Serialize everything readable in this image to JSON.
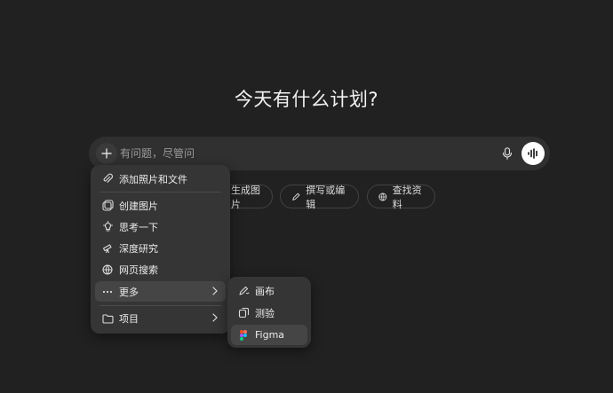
{
  "heading": "今天有什么计划?",
  "composer": {
    "placeholder": "有问题，尽管问"
  },
  "chips": [
    {
      "label": "生成图片",
      "icon": "image-icon"
    },
    {
      "label": "撰写或编辑",
      "icon": "pencil-icon"
    },
    {
      "label": "查找资料",
      "icon": "globe-icon"
    }
  ],
  "menu": {
    "items": [
      {
        "label": "添加照片和文件",
        "icon": "paperclip-icon"
      },
      {
        "label": "创建图片",
        "icon": "image-icon"
      },
      {
        "label": "思考一下",
        "icon": "lightbulb-icon"
      },
      {
        "label": "深度研究",
        "icon": "telescope-icon"
      },
      {
        "label": "网页搜索",
        "icon": "globe-icon"
      },
      {
        "label": "更多",
        "icon": "more-dots-icon"
      },
      {
        "label": "项目",
        "icon": "folder-icon"
      }
    ]
  },
  "submenu": {
    "items": [
      {
        "label": "画布",
        "icon": "canvas-pen-icon"
      },
      {
        "label": "测验",
        "icon": "copy-cards-icon"
      },
      {
        "label": "Figma",
        "icon": "figma-icon"
      }
    ]
  },
  "colors": {
    "background": "#212121",
    "surface": "#303030",
    "menu": "#353535",
    "highlight": "#454545",
    "text": "#ececec"
  }
}
